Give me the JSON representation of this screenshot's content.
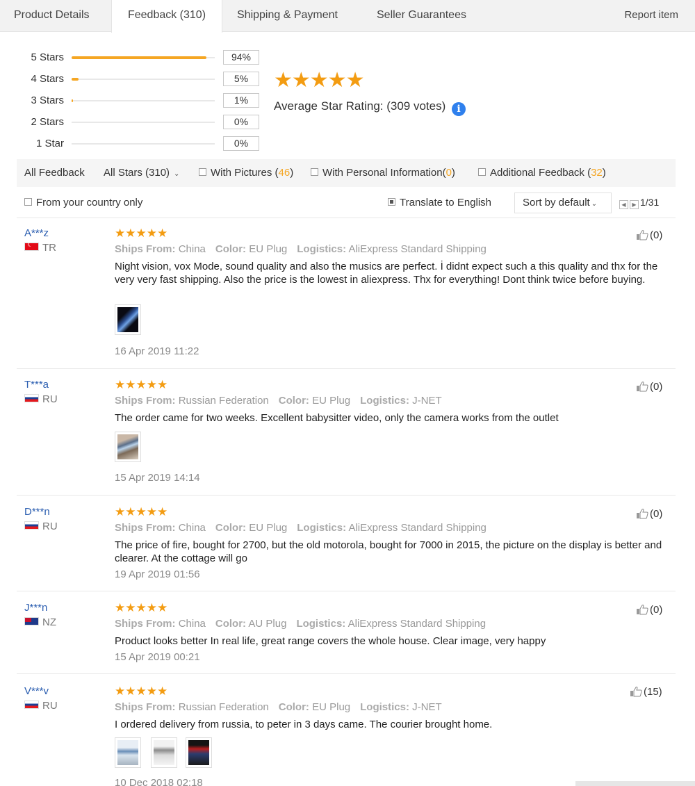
{
  "tabs": {
    "items": [
      {
        "label": "Product Details"
      },
      {
        "label": "Feedback (310)"
      },
      {
        "label": "Shipping & Payment"
      },
      {
        "label": "Seller Guarantees"
      }
    ],
    "active_index": 1,
    "report_label": "Report item"
  },
  "rating_summary": {
    "rows": [
      {
        "label": "5 Stars",
        "percent_text": "94%",
        "fill_fraction": 0.94
      },
      {
        "label": "4 Stars",
        "percent_text": "5%",
        "fill_fraction": 0.05
      },
      {
        "label": "3 Stars",
        "percent_text": "1%",
        "fill_fraction": 0.01
      },
      {
        "label": "2 Stars",
        "percent_text": "0%",
        "fill_fraction": 0
      },
      {
        "label": "1 Star",
        "percent_text": "0%",
        "fill_fraction": 0
      }
    ],
    "stars": "★★★★★",
    "average_label": "Average Star Rating:",
    "votes": "(309 votes)",
    "info_icon": "i"
  },
  "filters": {
    "all_feedback": "All Feedback",
    "all_stars": "All Stars (310)",
    "with_pictures": {
      "label": "With Pictures (",
      "count": "46",
      "close": ")"
    },
    "with_personal": {
      "label": "With Personal Information(",
      "count": "0",
      "close": ")"
    },
    "additional": {
      "label": "Additional Feedback (",
      "count": "32",
      "close": ")"
    },
    "from_country": "From your country only",
    "translate": "Translate to English",
    "translate_checked": true,
    "sort": "Sort by default",
    "page": "1/31"
  },
  "labels": {
    "ships_from": "Ships From:",
    "color": "Color:",
    "logistics": "Logistics:"
  },
  "reviews": [
    {
      "user": "A***z",
      "country": "TR",
      "stars": "★★★★★",
      "ships_from": "China",
      "color": "EU Plug",
      "logistics": "AliExpress Standard Shipping",
      "text": "Night vision, vox Mode, sound quality and also the musics are perfect. İ didnt expect such a this quality and thx for the very very fast shipping. Also the price is the lowest in aliexpress. Thx for everything! Dont think twice before buying.",
      "date": "16 Apr 2019 11:22",
      "likes": "(0)",
      "photos": 1
    },
    {
      "user": "T***a",
      "country": "RU",
      "stars": "★★★★★",
      "ships_from": "Russian Federation",
      "color": "EU Plug",
      "logistics": "J-NET",
      "text": "The order came for two weeks. Excellent babysitter video, only the camera works from the outlet",
      "date": "15 Apr 2019 14:14",
      "likes": "(0)",
      "photos": 1
    },
    {
      "user": "D***n",
      "country": "RU",
      "stars": "★★★★★",
      "ships_from": "China",
      "color": "EU Plug",
      "logistics": "AliExpress Standard Shipping",
      "text": "The price of fire, bought for 2700, but the old motorola, bought for 7000 in 2015, the picture on the display is better and clearer. At the cottage will go",
      "date": "19 Apr 2019 01:56",
      "likes": "(0)",
      "photos": 0
    },
    {
      "user": "J***n",
      "country": "NZ",
      "stars": "★★★★★",
      "ships_from": "China",
      "color": "AU Plug",
      "logistics": "AliExpress Standard Shipping",
      "text": "Product looks better In real life, great range covers the whole house. Clear image, very happy",
      "date": "15 Apr 2019 00:21",
      "likes": "(0)",
      "photos": 0
    },
    {
      "user": "V***v",
      "country": "RU",
      "stars": "★★★★★",
      "ships_from": "Russian Federation",
      "color": "EU Plug",
      "logistics": "J-NET",
      "text": "I ordered delivery from russia, to peter in 3 days came. The courier brought home.",
      "date": "10 Dec 2018 02:18",
      "likes": "(15)",
      "photos": 3
    }
  ]
}
